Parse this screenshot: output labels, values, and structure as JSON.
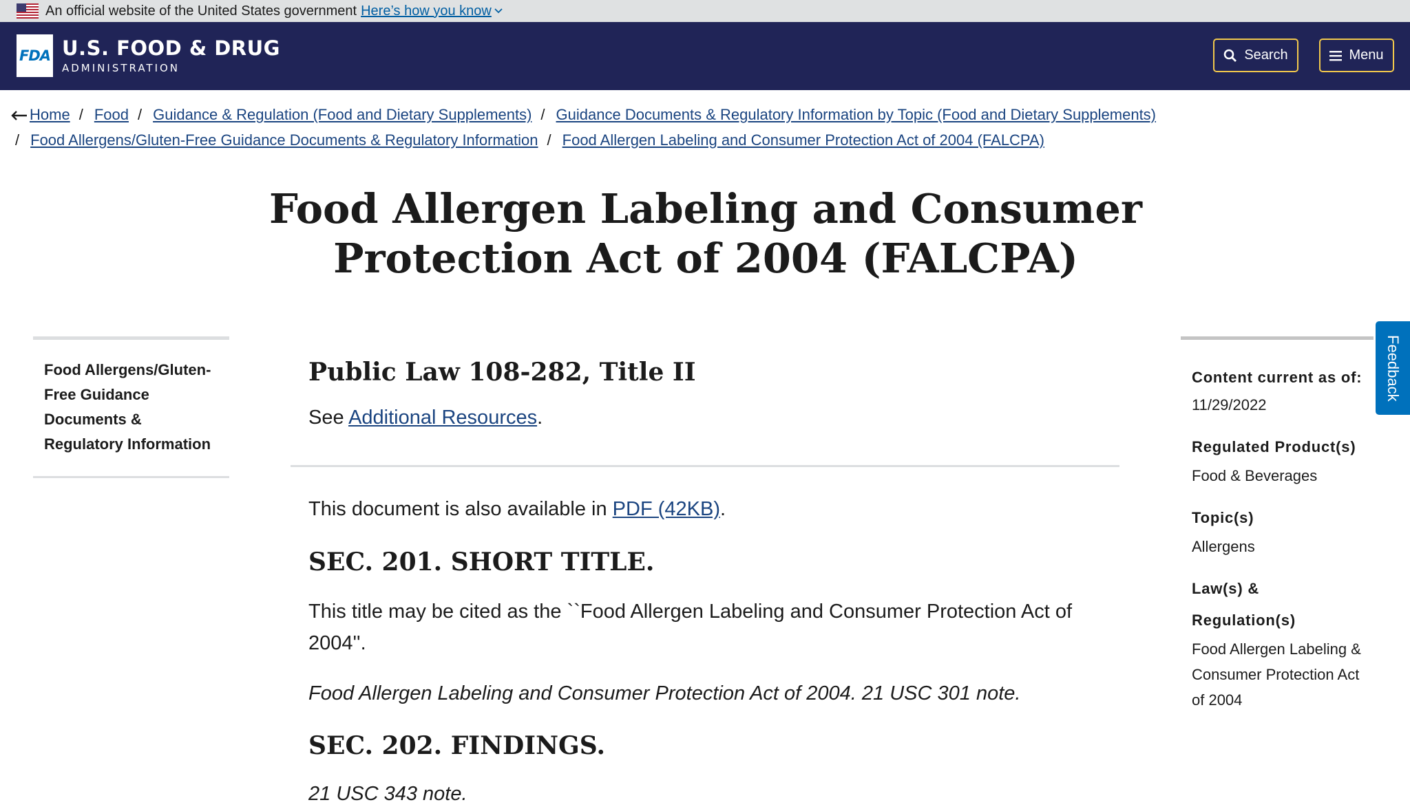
{
  "gov_banner": {
    "text": "An official website of the United States government",
    "link": "Here’s how you know",
    "icon": "us-flag-icon"
  },
  "header": {
    "logo_text": "FDA",
    "org_line1": "U.S. FOOD & DRUG",
    "org_line2": "ADMINISTRATION",
    "search_label": "Search",
    "menu_label": "Menu",
    "accent_color": "#f2c94c",
    "background_color": "#202457"
  },
  "breadcrumb": {
    "items": [
      "Home",
      "Food",
      "Guidance & Regulation (Food and Dietary Supplements)",
      "Guidance Documents & Regulatory Information by Topic (Food and Dietary Supplements)",
      "Food Allergens/Gluten-Free Guidance Documents & Regulatory Information",
      "Food Allergen Labeling and Consumer Protection Act of 2004 (FALCPA)"
    ],
    "separator": "/"
  },
  "page": {
    "title": "Food Allergen Labeling and Consumer Protection Act of 2004 (FALCPA)"
  },
  "left_nav": {
    "label": "Food Allergens/Gluten-Free Guidance Documents & Regulatory Information"
  },
  "main": {
    "law_heading": "Public Law 108-282, Title II",
    "see_prefix": "See ",
    "see_link": "Additional Resources",
    "see_suffix": ".",
    "avail_prefix": "This document is also available in ",
    "avail_link": "PDF (42KB)",
    "avail_suffix": ".",
    "sec201_heading": "SEC. 201. SHORT TITLE.",
    "sec201_text": "This title may be cited as the ``Food Allergen Labeling and Consumer Protection Act of 2004''.",
    "sec201_cite": "Food Allergen Labeling and Consumer Protection Act of 2004. 21 USC 301 note.",
    "sec202_heading": "SEC. 202. FINDINGS.",
    "sec202_cite": "21 USC 343 note."
  },
  "sidebar": {
    "content_current_label": "Content current as of:",
    "content_current_value": "11/29/2022",
    "regulated_label": "Regulated Product(s)",
    "regulated_value": "Food & Beverages",
    "topics_label": "Topic(s)",
    "topics_value": "Allergens",
    "laws_label_1": "Law(s) &",
    "laws_label_2": "Regulation(s)",
    "laws_value": "Food Allergen Labeling & Consumer Protection Act of 2004"
  },
  "feedback": {
    "label": "Feedback"
  }
}
